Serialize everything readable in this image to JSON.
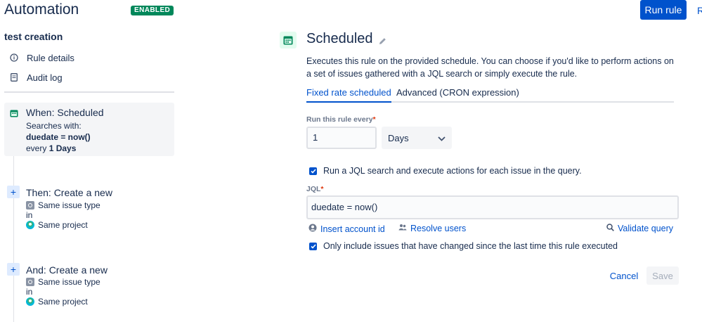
{
  "header": {
    "title": "Automation",
    "status_badge": "ENABLED",
    "run_rule_label": "Run rule",
    "cut_link_label": "R"
  },
  "sidebar": {
    "rule_name": "test creation",
    "links": [
      {
        "label": "Rule details",
        "icon": "info-icon"
      },
      {
        "label": "Audit log",
        "icon": "document-icon"
      }
    ],
    "trigger": {
      "title": "When: Scheduled",
      "line1": "Searches with:",
      "jql": "duedate = now()",
      "every_prefix": "every",
      "every_value": "1 Days",
      "icon": "calendar-icon"
    },
    "actions": [
      {
        "title": "Then: Create a new",
        "issue_type": "Same issue type",
        "in": "in",
        "project": "Same project"
      },
      {
        "title": "And: Create a new",
        "issue_type": "Same issue type",
        "in": "in",
        "project": "Same project"
      }
    ]
  },
  "main": {
    "title": "Scheduled",
    "description": "Executes this rule on the provided schedule. You can choose if you'd like to perform actions on a set of issues gathered with a JQL search or simply execute the rule.",
    "tabs": [
      {
        "label": "Fixed rate scheduled",
        "active": true
      },
      {
        "label": "Advanced (CRON expression)",
        "active": false
      }
    ],
    "run_every_label": "Run this rule every",
    "required_mark": "*",
    "run_every_value": "1",
    "unit_selected": "Days",
    "jql_checkbox_label": "Run a JQL search and execute actions for each issue in the query.",
    "jql_checkbox_checked": true,
    "jql_label": "JQL",
    "jql_value": "duedate = now()",
    "insert_account_label": "Insert account id",
    "resolve_users_label": "Resolve users",
    "validate_query_label": "Validate query",
    "changed_checkbox_label": "Only include issues that have changed since the last time this rule executed",
    "changed_checkbox_checked": true,
    "cancel_label": "Cancel",
    "save_label": "Save"
  },
  "colors": {
    "primary": "#0052cc",
    "success": "#00875a",
    "text": "#172b4d",
    "required": "#de350b"
  }
}
